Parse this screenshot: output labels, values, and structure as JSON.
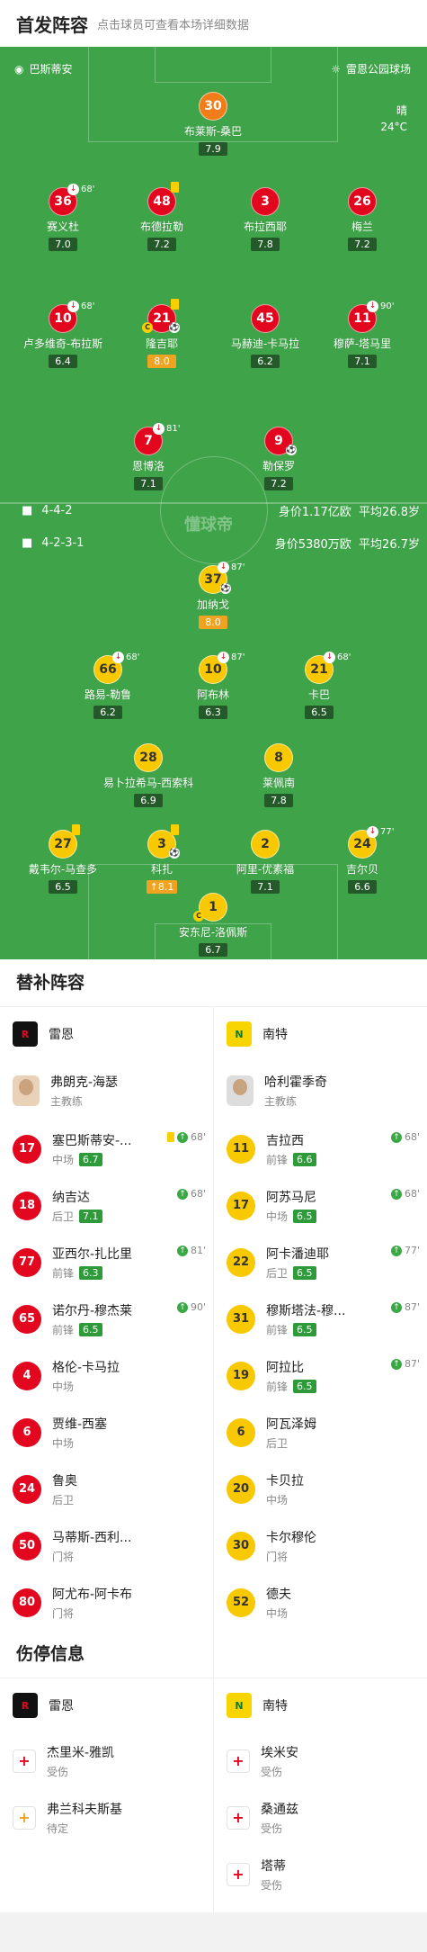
{
  "header": {
    "title": "首发阵容",
    "subtitle": "点击球员可查看本场详细数据"
  },
  "pitch": {
    "home_team": "巴斯蒂安",
    "venue": "雷恩公园球场",
    "weather": "晴",
    "temp": "24°C",
    "watermark": "懂球帝",
    "home_formation": "4-4-2",
    "home_value": "身价1.17亿欧",
    "home_age": "平均26.8岁",
    "away_formation": "4-2-3-1",
    "away_value": "身价5380万欧",
    "away_age": "平均26.7岁"
  },
  "home_players": [
    {
      "num": "30",
      "name": "布莱斯-桑巴",
      "rating": "7.9",
      "color": "ora"
    },
    {
      "num": "36",
      "name": "赛义杜",
      "rating": "7.0",
      "sub": "68'"
    },
    {
      "num": "48",
      "name": "布德拉勒",
      "rating": "7.2",
      "card": true
    },
    {
      "num": "3",
      "name": "布拉西耶",
      "rating": "7.8"
    },
    {
      "num": "26",
      "name": "梅兰",
      "rating": "7.2"
    },
    {
      "num": "10",
      "name": "卢多维奇-布拉斯",
      "rating": "6.4",
      "sub": "68'"
    },
    {
      "num": "21",
      "name": "隆吉耶",
      "rating": "8.0",
      "gold": true,
      "card": true,
      "ball": true,
      "cap": true
    },
    {
      "num": "45",
      "name": "马赫迪-卡马拉",
      "rating": "6.2"
    },
    {
      "num": "11",
      "name": "穆萨-塔马里",
      "rating": "7.1",
      "sub": "90'"
    },
    {
      "num": "7",
      "name": "恩博洛",
      "rating": "7.1",
      "sub": "81'"
    },
    {
      "num": "9",
      "name": "勒保罗",
      "rating": "7.2",
      "ball": true
    }
  ],
  "away_players": [
    {
      "num": "37",
      "name": "加纳戈",
      "rating": "8.0",
      "gold": true,
      "sub": "87'",
      "ball": true
    },
    {
      "num": "66",
      "name": "路易-勒鲁",
      "rating": "6.2",
      "sub": "68'"
    },
    {
      "num": "10",
      "name": "阿布林",
      "rating": "6.3",
      "sub": "87'"
    },
    {
      "num": "21",
      "name": "卡巴",
      "rating": "6.5",
      "sub": "68'"
    },
    {
      "num": "28",
      "name": "易卜拉希马-西索科",
      "rating": "6.9"
    },
    {
      "num": "8",
      "name": "莱佩南",
      "rating": "7.8"
    },
    {
      "num": "27",
      "name": "戴韦尔-马查多",
      "rating": "6.5",
      "card": true
    },
    {
      "num": "3",
      "name": "科扎",
      "rating": "8.1",
      "gold": true,
      "card": true,
      "ball": true,
      "arrow": "↑"
    },
    {
      "num": "2",
      "name": "阿里-优素福",
      "rating": "7.1"
    },
    {
      "num": "24",
      "name": "吉尔贝",
      "rating": "6.6",
      "sub": "77'"
    },
    {
      "num": "1",
      "name": "安东尼-洛佩斯",
      "rating": "6.7",
      "cap": true
    }
  ],
  "subs": {
    "title": "替补阵容",
    "home_team": "雷恩",
    "away_team": "南特",
    "home_coach": {
      "name": "弗朗克-海瑟",
      "role": "主教练"
    },
    "away_coach": {
      "name": "哈利霍季奇",
      "role": "主教练"
    },
    "home": [
      {
        "num": "17",
        "name": "塞巴斯蒂安-...",
        "pos": "中场",
        "rating": "6.7",
        "ev": "68'",
        "card": true
      },
      {
        "num": "18",
        "name": "纳吉达",
        "pos": "后卫",
        "rating": "7.1",
        "ev": "68'"
      },
      {
        "num": "77",
        "name": "亚西尔-扎比里",
        "pos": "前锋",
        "rating": "6.3",
        "ev": "81'"
      },
      {
        "num": "65",
        "name": "诺尔丹-穆杰莱",
        "pos": "前锋",
        "rating": "6.5",
        "ev": "90'"
      },
      {
        "num": "4",
        "name": "格伦-卡马拉",
        "pos": "中场"
      },
      {
        "num": "6",
        "name": "贾维-西塞",
        "pos": "中场"
      },
      {
        "num": "24",
        "name": "鲁奥",
        "pos": "后卫"
      },
      {
        "num": "50",
        "name": "马蒂斯-西利...",
        "pos": "门将"
      },
      {
        "num": "80",
        "name": "阿尤布-阿卡布",
        "pos": "门将"
      }
    ],
    "away": [
      {
        "num": "11",
        "name": "吉拉西",
        "pos": "前锋",
        "rating": "6.6",
        "ev": "68'"
      },
      {
        "num": "17",
        "name": "阿苏马尼",
        "pos": "中场",
        "rating": "6.5",
        "ev": "68'"
      },
      {
        "num": "22",
        "name": "阿卡潘迪耶",
        "pos": "后卫",
        "rating": "6.5",
        "ev": "77'"
      },
      {
        "num": "31",
        "name": "穆斯塔法-穆...",
        "pos": "前锋",
        "rating": "6.5",
        "ev": "87'"
      },
      {
        "num": "19",
        "name": "阿拉比",
        "pos": "前锋",
        "rating": "6.5",
        "ev": "87'"
      },
      {
        "num": "6",
        "name": "阿瓦泽姆",
        "pos": "后卫"
      },
      {
        "num": "20",
        "name": "卡贝拉",
        "pos": "中场"
      },
      {
        "num": "30",
        "name": "卡尔穆伦",
        "pos": "门将"
      },
      {
        "num": "52",
        "name": "德夫",
        "pos": "中场"
      }
    ]
  },
  "injuries": {
    "title": "伤停信息",
    "home_team": "雷恩",
    "away_team": "南特",
    "home": [
      {
        "name": "杰里米-雅凯",
        "status": "受伤"
      },
      {
        "name": "弗兰科夫斯基",
        "status": "待定"
      }
    ],
    "away": [
      {
        "name": "埃米安",
        "status": "受伤"
      },
      {
        "name": "桑通兹",
        "status": "受伤"
      },
      {
        "name": "塔蒂",
        "status": "受伤"
      }
    ]
  }
}
